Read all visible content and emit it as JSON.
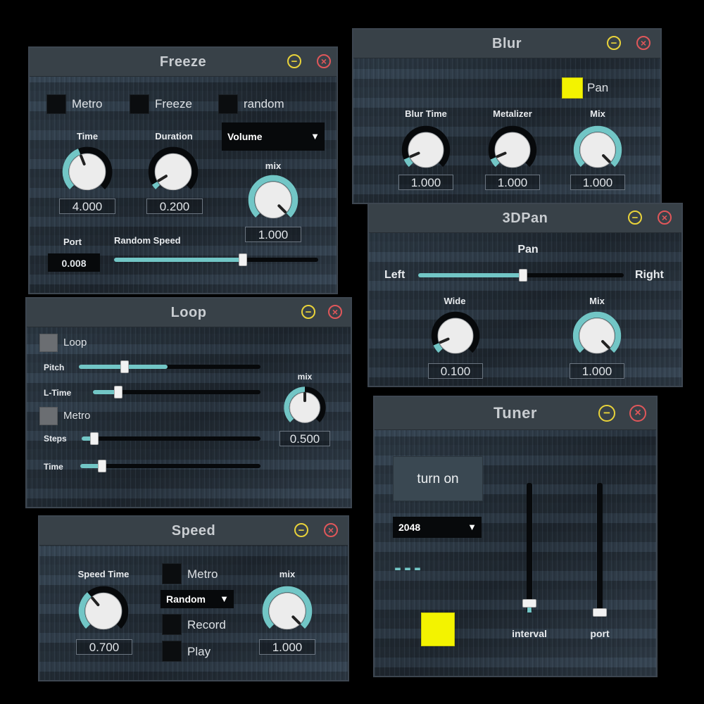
{
  "colors": {
    "accent": "#72c6c6",
    "knob_track": "#07090b",
    "minimize": "#e9d33a",
    "close": "#e0575a",
    "indicator": "#f3f300"
  },
  "icons": {
    "minimize": "minus-circle-icon",
    "close": "x-circle-icon",
    "dropdown": "triangle-down-icon"
  },
  "freeze": {
    "title": "Freeze",
    "minimize_glyph": "−",
    "close_glyph": "×",
    "checkboxes": {
      "metro": "Metro",
      "freeze": "Freeze",
      "random": "random"
    },
    "time": {
      "label": "Time",
      "value": "4.000",
      "level": 0.42
    },
    "duration": {
      "label": "Duration",
      "value": "0.200",
      "level": 0.05
    },
    "mode_select": {
      "value": "Volume",
      "arrow": "▼"
    },
    "mix": {
      "label": "mix",
      "value": "1.000",
      "level": 1.0
    },
    "port": {
      "label": "Port",
      "value": "0.008"
    },
    "random_speed": {
      "label": "Random Speed",
      "level": 0.63
    }
  },
  "blur": {
    "title": "Blur",
    "minimize_glyph": "−",
    "close_glyph": "×",
    "pan_label": "Pan",
    "blur_time": {
      "label": "Blur Time",
      "value": "1.000",
      "level": 0.08
    },
    "metalizer": {
      "label": "Metalizer",
      "value": "1.000",
      "level": 0.08
    },
    "mix": {
      "label": "Mix",
      "value": "1.000",
      "level": 1.0
    }
  },
  "pan3d": {
    "title": "3DPan",
    "minimize_glyph": "−",
    "close_glyph": "×",
    "pan": {
      "label": "Pan",
      "left": "Left",
      "right": "Right",
      "level": 0.51
    },
    "wide": {
      "label": "Wide",
      "value": "0.100",
      "level": 0.08
    },
    "mix": {
      "label": "Mix",
      "value": "1.000",
      "level": 1.0
    }
  },
  "loop": {
    "title": "Loop",
    "minimize_glyph": "−",
    "close_glyph": "×",
    "loop_label": "Loop",
    "metro_label": "Metro",
    "pitch": {
      "label": "Pitch",
      "level": 0.25,
      "fill_end": 0.49
    },
    "l_time": {
      "label": "L-Time",
      "level": 0.15
    },
    "steps": {
      "label": "Steps",
      "level": 0.07
    },
    "time": {
      "label": "Time",
      "level": 0.12
    },
    "mix": {
      "label": "mix",
      "value": "0.500",
      "level": 0.5
    }
  },
  "speed": {
    "title": "Speed",
    "minimize_glyph": "−",
    "close_glyph": "×",
    "speed_time": {
      "label": "Speed Time",
      "value": "0.700",
      "level": 0.35
    },
    "metro_label": "Metro",
    "mode_select": {
      "value": "Random",
      "arrow": "▼"
    },
    "record_label": "Record",
    "play_label": "Play",
    "mix": {
      "label": "mix",
      "value": "1.000",
      "level": 1.0
    }
  },
  "tuner": {
    "title": "Tuner",
    "minimize_glyph": "−",
    "close_glyph": "×",
    "turn_on_label": "turn on",
    "size_select": {
      "value": "2048",
      "arrow": "▼"
    },
    "note_display": "---",
    "interval": {
      "label": "interval",
      "level": 0.07
    },
    "port": {
      "label": "port",
      "level": 0.0
    }
  }
}
